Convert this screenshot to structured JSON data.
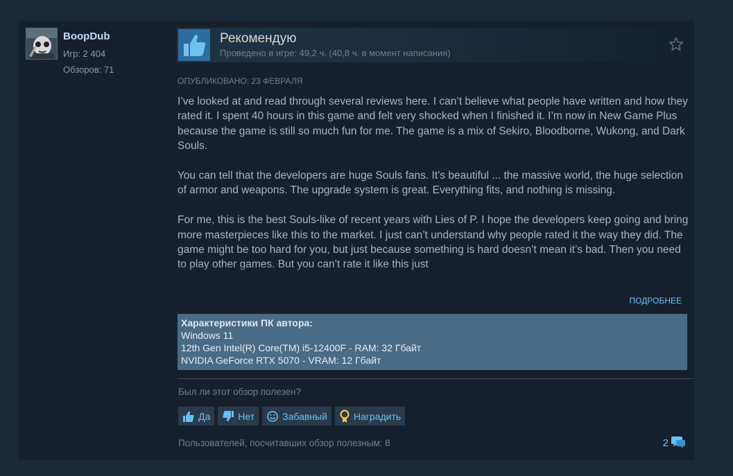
{
  "author": {
    "name": "BoopDub",
    "games": "Игр: 2 404",
    "reviews": "Обзоров: 71"
  },
  "review": {
    "verdict": "Рекомендую",
    "playtime": "Проведено в игре: 49,2 ч. (40,8 ч. в момент написания)",
    "posted": "Опубликовано: 23 февраля",
    "paragraphs": [
      "I’ve looked at and read through several reviews here. I can’t believe what people have written and how they rated it. I spent 40 hours in this game and felt very shocked when I finished it. I’m now in New Game Plus because the game is still so much fun for me. The game is a mix of Sekiro, Bloodborne, Wukong, and Dark Souls.",
      "You can tell that the developers are huge Souls fans. It’s beautiful ... the massive world, the huge selection of armor and weapons. The upgrade system is great. Everything fits, and nothing is missing.",
      "For me, this is the best Souls-like of recent years with Lies of P. I hope the developers keep going and bring more masterpieces like this to the market. I just can’t understand why people rated it the way they did. The game might be too hard for you, but just because something is hard doesn’t mean it’s bad. Then you need to play other games. But you can’t rate it like this just"
    ],
    "read_more": "Подробнее"
  },
  "specs": {
    "title": "Характеристики ПК автора:",
    "os": "Windows 11",
    "cpu": "12th Gen Intel(R) Core(TM) i5-12400F - RAM: 32 Гбайт",
    "gpu": "NVIDIA GeForce RTX 5070 - VRAM: 12 Гбайт"
  },
  "feedback": {
    "question": "Был ли этот обзор полезен?",
    "yes": "Да",
    "no": "Нет",
    "funny": "Забавный",
    "award": "Наградить",
    "helpful_count": "Пользователей, посчитавших обзор полезным: 8",
    "comments_count": "2"
  },
  "icons": {
    "thumb": "thumbs-up-icon",
    "star": "star-outline-icon",
    "comment": "comment-bubble-icon"
  },
  "colors": {
    "background": "#1b2838",
    "card": "#16202d",
    "accent": "#67c1f5",
    "thumb_box": "#2c6d9e",
    "specs_bg": "#4a6b86"
  }
}
